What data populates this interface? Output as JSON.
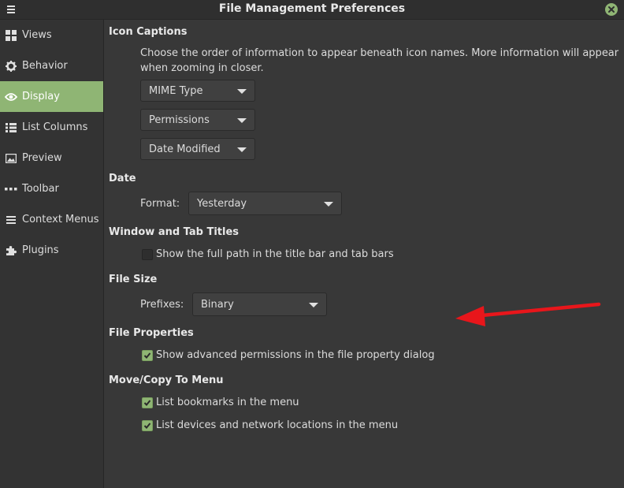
{
  "window": {
    "title": "File Management Preferences"
  },
  "colors": {
    "accent": "#8fb574",
    "background": "#383838",
    "annotation_arrow": "#e8161b"
  },
  "sidebar": {
    "items": [
      {
        "label": "Views",
        "icon": "grid-icon",
        "active": false
      },
      {
        "label": "Behavior",
        "icon": "gear-icon",
        "active": false
      },
      {
        "label": "Display",
        "icon": "eye-icon",
        "active": true
      },
      {
        "label": "List Columns",
        "icon": "list-icon",
        "active": false
      },
      {
        "label": "Preview",
        "icon": "image-icon",
        "active": false
      },
      {
        "label": "Toolbar",
        "icon": "dots-icon",
        "active": false
      },
      {
        "label": "Context Menus",
        "icon": "menu-icon",
        "active": false
      },
      {
        "label": "Plugins",
        "icon": "puzzle-icon",
        "active": false
      }
    ]
  },
  "icon_captions": {
    "title": "Icon Captions",
    "description": "Choose the order of information to appear beneath icon names. More information will appear when zooming in closer.",
    "combos": [
      "MIME Type",
      "Permissions",
      "Date Modified"
    ]
  },
  "date": {
    "title": "Date",
    "format_label": "Format:",
    "format_value": "Yesterday"
  },
  "window_titles": {
    "title": "Window and Tab Titles",
    "full_path_label": "Show the full path in the title bar and tab bars",
    "full_path_checked": false
  },
  "file_size": {
    "title": "File Size",
    "prefixes_label": "Prefixes:",
    "prefixes_value": "Binary"
  },
  "file_properties": {
    "title": "File Properties",
    "advanced_permissions_label": "Show advanced permissions in the file property dialog",
    "advanced_permissions_checked": true
  },
  "move_copy": {
    "title": "Move/Copy To Menu",
    "bookmarks_label": "List bookmarks in the menu",
    "bookmarks_checked": true,
    "devices_label": "List devices and network locations in the menu",
    "devices_checked": true
  }
}
